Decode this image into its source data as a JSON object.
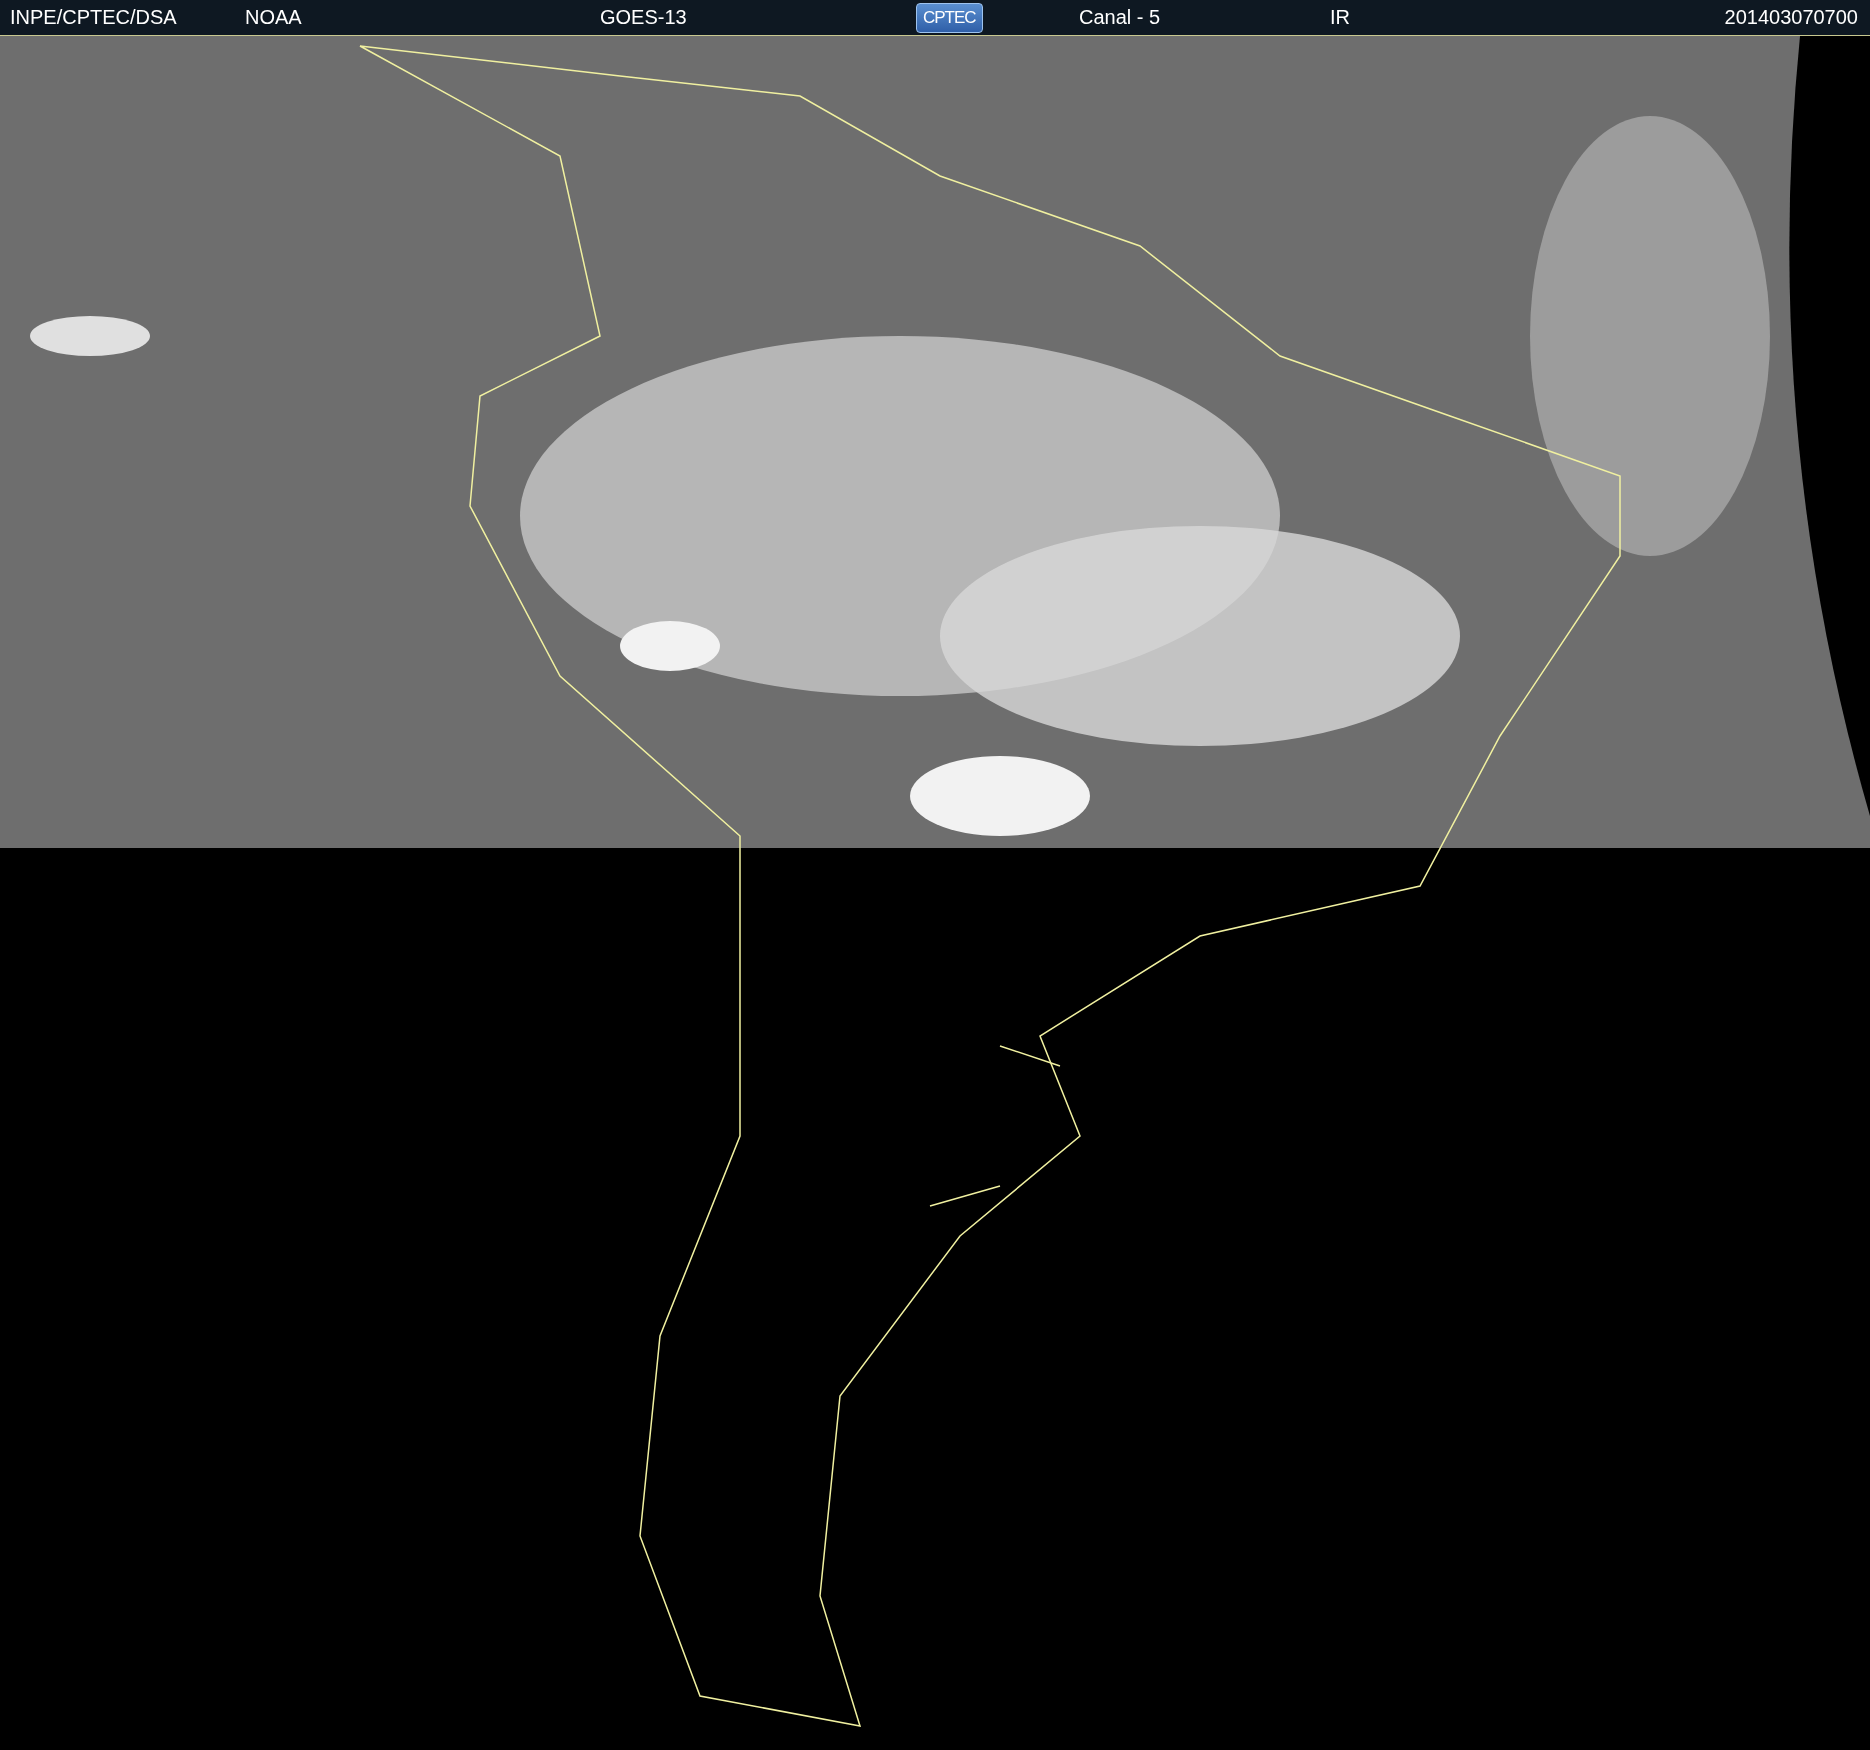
{
  "header": {
    "items": [
      {
        "kind": "text",
        "label": "INPE/CPTEC/DSA"
      },
      {
        "kind": "text",
        "label": "NOAA"
      },
      {
        "kind": "text",
        "label": "GOES-13"
      },
      {
        "kind": "logo",
        "label": "CPTEC"
      },
      {
        "kind": "text",
        "label": "Canal - 5"
      },
      {
        "kind": "text",
        "label": "IR"
      },
      {
        "kind": "text",
        "label": "201403070700"
      }
    ]
  }
}
